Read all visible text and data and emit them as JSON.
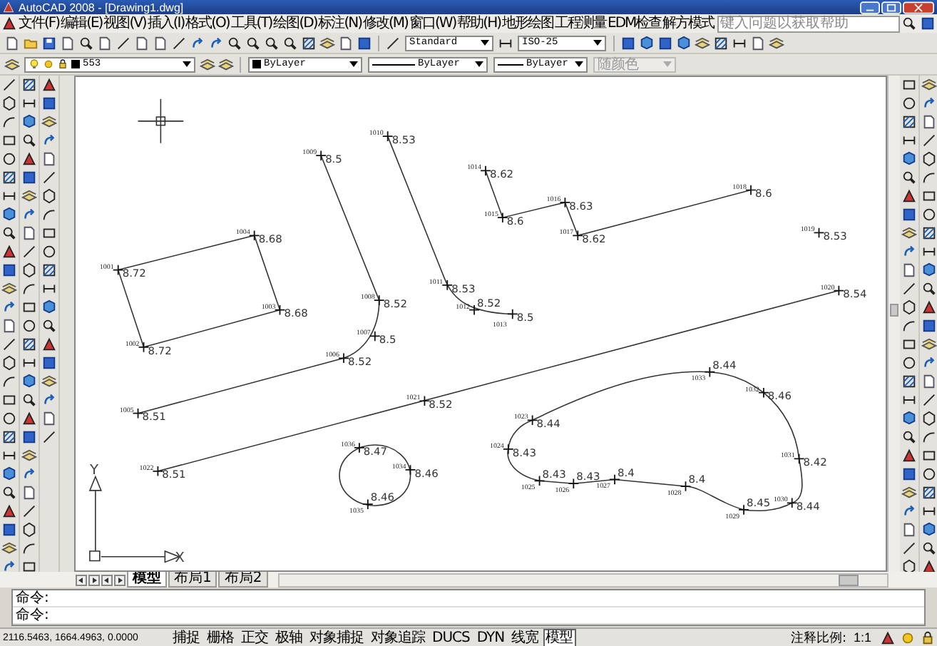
{
  "window": {
    "title": "AutoCAD 2008 - [Drawing1.dwg]"
  },
  "menu": [
    "文件(F)",
    "编辑(E)",
    "视图(V)",
    "插入(I)",
    "格式(O)",
    "工具(T)",
    "绘图(D)",
    "标注(N)",
    "修改(M)",
    "窗口(W)",
    "帮助(H)",
    "地形绘图",
    "工程测量",
    "EDM检查",
    "解方模式"
  ],
  "help_search": {
    "placeholder": "键入问题以获取帮助"
  },
  "styles_toolbar": {
    "text_style": "Standard",
    "dim_style": "ISO-25"
  },
  "layers_toolbar": {
    "layer": "553",
    "color_value": "ByLayer",
    "linetype": "ByLayer",
    "lineweight": "ByLayer",
    "plot_style": {
      "value": "随颜色",
      "disabled": true
    }
  },
  "drawing": {
    "points": [
      {
        "number": "1001",
        "elevation": "8.72"
      },
      {
        "number": "1002",
        "elevation": "8.72"
      },
      {
        "number": "1003",
        "elevation": "8.68"
      },
      {
        "number": "1004",
        "elevation": "8.68"
      },
      {
        "number": "1005",
        "elevation": "8.51"
      },
      {
        "number": "1006",
        "elevation": "8.52"
      },
      {
        "number": "1008",
        "elevation": "8.52"
      },
      {
        "number": "1007",
        "elevation": "8.5"
      },
      {
        "number": "1009",
        "elevation": "8.5"
      },
      {
        "number": "1010",
        "elevation": "8.53"
      },
      {
        "number": "1011",
        "elevation": "8.53"
      },
      {
        "number": "1012",
        "elevation": "8.52"
      },
      {
        "number": "1013",
        "elevation": "8.5"
      },
      {
        "number": "1014",
        "elevation": "8.62"
      },
      {
        "number": "1015",
        "elevation": "8.6"
      },
      {
        "number": "1016",
        "elevation": "8.63"
      },
      {
        "number": "1017",
        "elevation": "8.62"
      },
      {
        "number": "1018",
        "elevation": "8.6"
      },
      {
        "number": "1019",
        "elevation": "8.53"
      },
      {
        "number": "1020",
        "elevation": "8.54"
      },
      {
        "number": "1021",
        "elevation": "8.52"
      },
      {
        "number": "1022",
        "elevation": "8.51"
      },
      {
        "number": "1023",
        "elevation": "8.44"
      },
      {
        "number": "1024",
        "elevation": "8.43"
      },
      {
        "number": "1025",
        "elevation": "8.43"
      },
      {
        "number": "1026",
        "elevation": "8.43"
      },
      {
        "number": "1027",
        "elevation": "8.4"
      },
      {
        "number": "1028",
        "elevation": "8.4"
      },
      {
        "number": "1029",
        "elevation": "8.45"
      },
      {
        "number": "1031",
        "elevation": "8.42"
      },
      {
        "number": "1030",
        "elevation": "8.44"
      },
      {
        "number": "1032",
        "elevation": "8.46"
      },
      {
        "number": "1033",
        "elevation": "8.44"
      },
      {
        "number": "1036",
        "elevation": "8.47"
      },
      {
        "number": "1034",
        "elevation": "8.46"
      },
      {
        "number": "1035",
        "elevation": "8.46"
      }
    ],
    "ucs": {
      "x_label": "X",
      "y_label": "Y"
    }
  },
  "layout_tabs": [
    {
      "label": "模型",
      "selected": true
    },
    {
      "label": "布局1",
      "selected": false
    },
    {
      "label": "布局2",
      "selected": false
    }
  ],
  "command_lines": [
    "命令:",
    "命令:"
  ],
  "status_bar": {
    "coordinates": "2116.5463, 1664.4963, 0.0000",
    "toggles": [
      {
        "label": "捕捉",
        "on": false
      },
      {
        "label": "栅格",
        "on": false
      },
      {
        "label": "正交",
        "on": false
      },
      {
        "label": "极轴",
        "on": false
      },
      {
        "label": "对象捕捉",
        "on": false
      },
      {
        "label": "对象追踪",
        "on": false
      },
      {
        "label": "DUCS",
        "on": false
      },
      {
        "label": "DYN",
        "on": false
      },
      {
        "label": "线宽",
        "on": false
      },
      {
        "label": "模型",
        "on": true
      }
    ],
    "annotation_scale_label": "注释比例:",
    "annotation_scale": "1:1"
  }
}
